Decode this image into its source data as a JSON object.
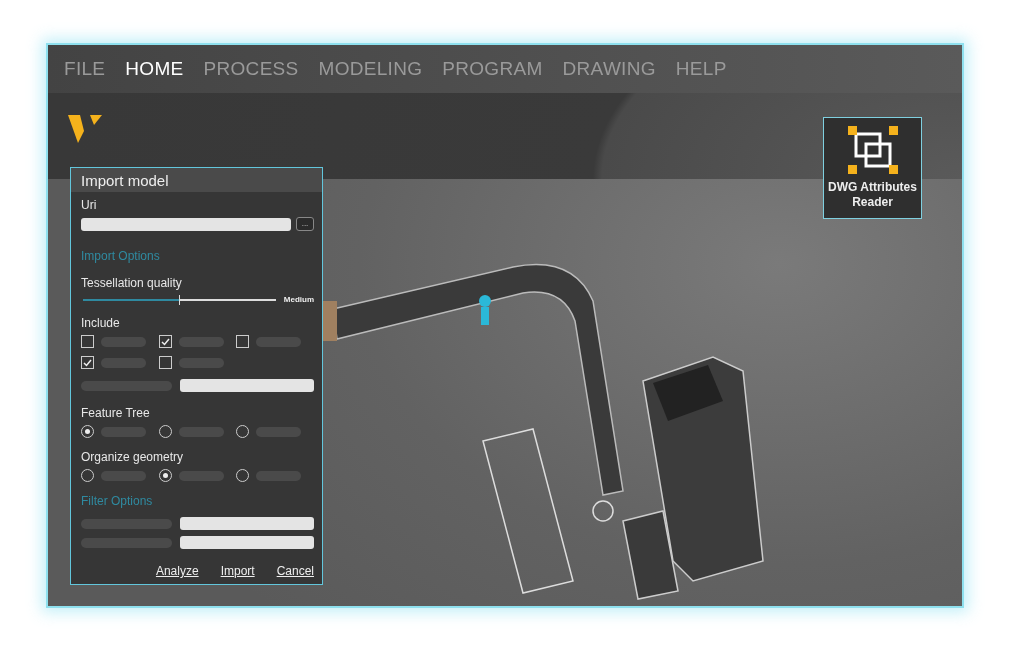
{
  "menu": [
    {
      "label": "FILE",
      "selected": false
    },
    {
      "label": "HOME",
      "selected": true
    },
    {
      "label": "PROCESS",
      "selected": false
    },
    {
      "label": "MODELING",
      "selected": false
    },
    {
      "label": "PROGRAM",
      "selected": false
    },
    {
      "label": "DRAWING",
      "selected": false
    },
    {
      "label": "HELP",
      "selected": false
    }
  ],
  "ribbon": {
    "tool": {
      "label": "DWG Attributes Reader"
    }
  },
  "dialog": {
    "title": "Import model",
    "uri": {
      "label": "Uri",
      "browse": "..."
    },
    "import_options": {
      "heading": "Import Options",
      "tessellation": {
        "label": "Tessellation quality",
        "level": 0.5,
        "reading": "Medium"
      },
      "include": {
        "label": "Include",
        "options": [
          {
            "checked": false
          },
          {
            "checked": true
          },
          {
            "checked": false
          },
          {
            "checked": true
          },
          {
            "checked": false
          }
        ]
      },
      "feature_tree": {
        "label": "Feature Tree",
        "options": [
          {
            "selected": true
          },
          {
            "selected": false
          },
          {
            "selected": false
          }
        ]
      },
      "organize_geometry": {
        "label": "Organize geometry",
        "options": [
          {
            "selected": false
          },
          {
            "selected": true
          },
          {
            "selected": false
          }
        ]
      }
    },
    "filter_options": {
      "heading": "Filter Options"
    },
    "buttons": [
      "Analyze",
      "Import",
      "Cancel"
    ]
  }
}
